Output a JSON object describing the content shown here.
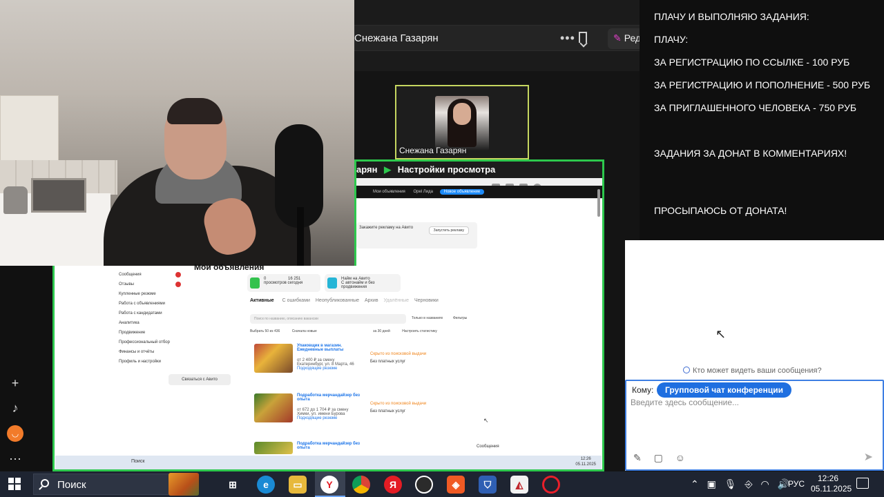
{
  "meeting": {
    "title": "Снежана Газарян",
    "edit_label": "Реда"
  },
  "participant_tile": {
    "name": "Снежана Газарян"
  },
  "share": {
    "header_left": "арян",
    "header_right": "Настройки просмотра",
    "page_title": "Мои объявления",
    "nav_items": [
      "Сообщения",
      "Отзывы",
      "Купленные резюме",
      "Работа с объявлениями",
      "Работа с кандидатами",
      "Аналитика",
      "Продвижение",
      "Профессиональный отбор",
      "Финансы и отчёты",
      "Профиль и настройки"
    ],
    "avito_button": "Связаться с Авито",
    "app_header_items": [
      "Мои объявления",
      "Opel Лида",
      "Новое объявление"
    ],
    "promo_text": "Закажите рекламу на Авито",
    "promo_button": "Запустить рекламу",
    "stat1_value": "0",
    "stat1_sub": "просмотров сегодня",
    "stat1_value2": "16 251",
    "stat1_sub2": "за неделю",
    "stat2_title": "Найм на Авито",
    "stat2_sub": "С автонайм и без продвижения",
    "tabs": [
      {
        "label": "Активные",
        "count": "476"
      },
      {
        "label": "С ошибками",
        "count": "7"
      },
      {
        "label": "Неопубликованные",
        "count": "12 572"
      },
      {
        "label": "Архив",
        "count": "1 168"
      },
      {
        "label": "Удалённые",
        "count": ""
      },
      {
        "label": "Черновики",
        "count": "18"
      }
    ],
    "search_placeholder": "Поиск по названию, описанию вакансии",
    "only_in_messages": "Только в названиях",
    "filters_label": "Фильтры",
    "select_all": "Выбрать 50 из 436",
    "sort_label": "Сначала новые",
    "period_label": "за 30 дней",
    "stats_settings": "Настроить статистику",
    "ads": [
      {
        "title": "Упаковщик в магазин. Ежедневные выплаты",
        "price": "от 2 400 ₽ за смену",
        "location": "Екатеринбург, ул. 8 Марта, 46",
        "note": "Подходящие резюме",
        "status": "Скрыто из поисковой выдачи",
        "extra": "Без платных услуг"
      },
      {
        "title": "Подработка мерчандайзер без опыта",
        "price": "от 672 до 1 704 ₽ за смену",
        "location": "Химки, ул. имени Бурова",
        "note": "Подходящие резюме",
        "status": "Скрыто из поисковой выдачи",
        "extra": "Без платных услуг"
      },
      {
        "title": "Подработка мерчандайзер без опыта",
        "price": "",
        "location": "",
        "note": "",
        "status": "",
        "extra": ""
      }
    ],
    "messages_chip": "Сообщения",
    "mini_time": "12:26",
    "mini_date": "05.11.2025",
    "mini_search": "Поиск"
  },
  "overlay": {
    "line1": "ПЛАЧУ И ВЫПОЛНЯЮ ЗАДАНИЯ:",
    "line2": "ПЛАЧУ:",
    "line3": " ЗА РЕГИСТРАЦИЮ ПО ССЫЛКЕ - 100 РУБ",
    "line4": "ЗА РЕГИСТРАЦИЮ И ПОПОЛНЕНИЕ - 500 РУБ",
    "line5": "ЗА ПРИГЛАШЕННОГО ЧЕЛОВЕКА - 750 РУБ",
    "line6": "ЗАДАНИЯ ЗА ДОНАТ В КОММЕНТАРИЯХ!",
    "line7": "ПРОСЫПАЮСЬ ОТ ДОНАТА!"
  },
  "chat": {
    "who_sees": "Кто может видеть ваши сообщения?",
    "to_label": "Кому:",
    "to_value": "Групповой чат конференции",
    "input_placeholder": "Введите здесь сообщение..."
  },
  "taskbar": {
    "search_label": "Поиск",
    "lang": "РУС",
    "time": "12:26",
    "date": "05.11.2025",
    "apps": [
      "task-view",
      "edge",
      "explorer",
      "yandex",
      "chrome",
      "yandex-browser",
      "obs",
      "brave",
      "defender",
      "photos",
      "opera"
    ]
  }
}
